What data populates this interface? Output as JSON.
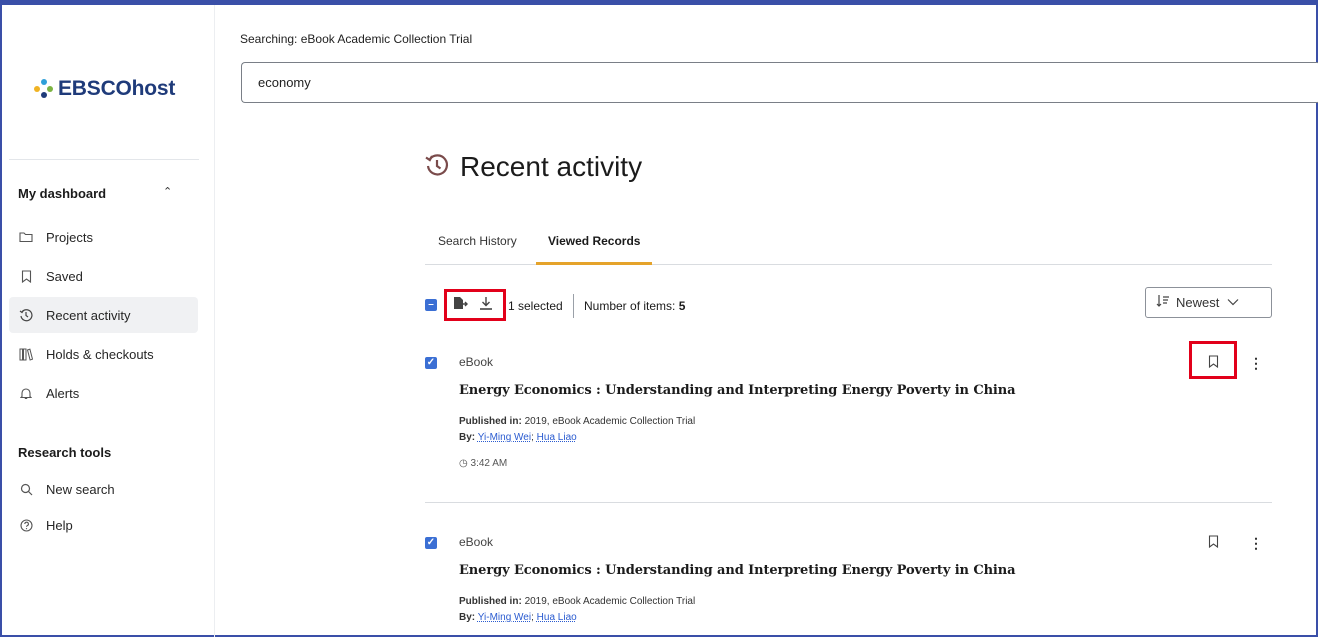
{
  "brand": {
    "logo_text": "EBSCOhost",
    "logo_colors": [
      "#2f9fd8",
      "#f0b323",
      "#7cb342",
      "#1f3b7a"
    ]
  },
  "search": {
    "context_label": "Searching:",
    "database": "eBook Academic Collection Trial",
    "query": "economy"
  },
  "sidebar": {
    "dashboard_heading": "My dashboard",
    "dashboard_items": [
      {
        "label": "Projects",
        "icon": "folder-icon"
      },
      {
        "label": "Saved",
        "icon": "bookmark-icon"
      },
      {
        "label": "Recent activity",
        "icon": "history-icon",
        "active": true
      },
      {
        "label": "Holds & checkouts",
        "icon": "books-icon"
      },
      {
        "label": "Alerts",
        "icon": "bell-icon"
      }
    ],
    "tools_heading": "Research tools",
    "tools_items": [
      {
        "label": "New search",
        "icon": "search-icon"
      },
      {
        "label": "Help",
        "icon": "help-icon"
      }
    ]
  },
  "main": {
    "title": "Recent activity",
    "tabs": [
      {
        "label": "Search History"
      },
      {
        "label": "Viewed Records",
        "active": true
      }
    ],
    "toolbar": {
      "selected_text": "1 selected",
      "items_label": "Number of items:",
      "items_count": "5"
    },
    "sort": {
      "label": "Newest"
    },
    "records": [
      {
        "type": "eBook",
        "title": "Energy Economics : Understanding and Interpreting Energy Poverty in China",
        "published_label": "Published in:",
        "published_value": "2019, eBook Academic Collection Trial",
        "by_label": "By:",
        "authors": [
          "Yi-Ming Wei",
          "Hua Liao"
        ],
        "time": "3:42 AM",
        "checked": true
      },
      {
        "type": "eBook",
        "title": "Energy Economics : Understanding and Interpreting Energy Poverty in China",
        "published_label": "Published in:",
        "published_value": "2019, eBook Academic Collection Trial",
        "by_label": "By:",
        "authors": [
          "Yi-Ming Wei",
          "Hua Liao"
        ],
        "checked": true
      }
    ]
  },
  "colors": {
    "accent": "#3b6fd4",
    "tab_underline": "#e5a32a",
    "highlight_box": "#e2001a",
    "frame": "#3a4fa8"
  }
}
